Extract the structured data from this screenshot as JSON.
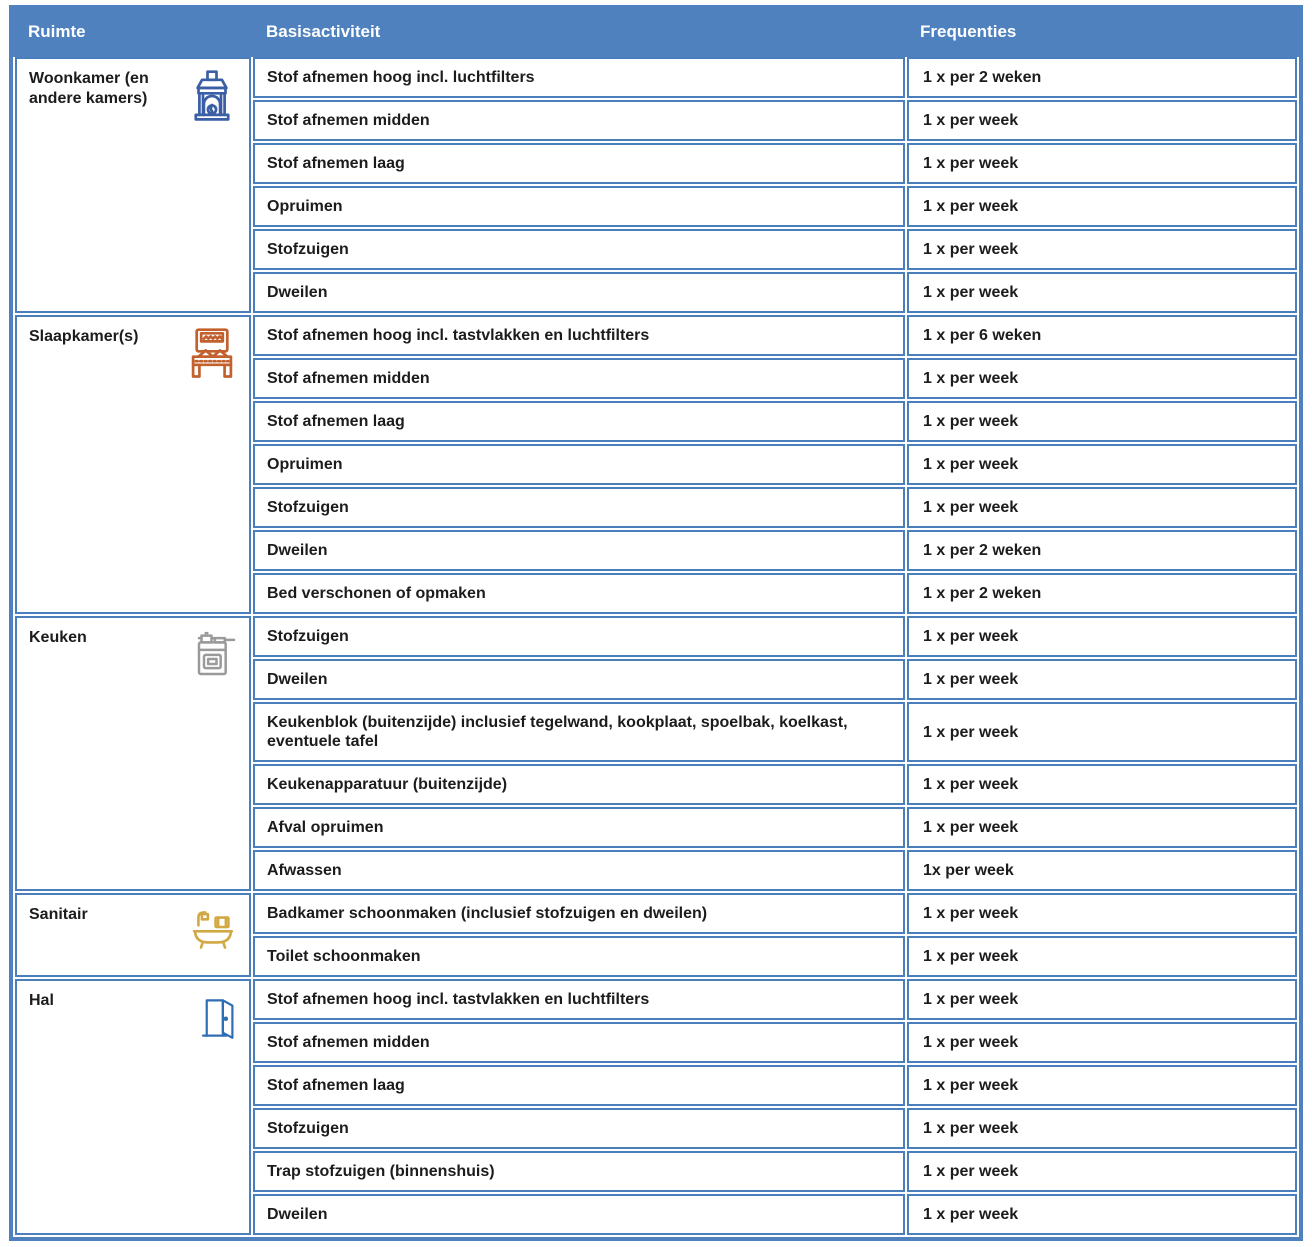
{
  "colors": {
    "header_bg": "#4e81bd",
    "cell_border": "#4a7ebc",
    "header_text": "#ffffff",
    "body_text": "#1c1c1c"
  },
  "table": {
    "headers": {
      "ruimte": "Ruimte",
      "basisactiviteit": "Basisactiviteit",
      "frequenties": "Frequenties"
    },
    "sections": [
      {
        "room": "Woonkamer (en andere kamers)",
        "icon": "fireplace-icon",
        "icon_color": "#3a5fa5",
        "rows": [
          {
            "activity": "Stof afnemen hoog incl. luchtfilters",
            "frequency": "1 x per 2 weken"
          },
          {
            "activity": "Stof afnemen midden",
            "frequency": "1 x per week"
          },
          {
            "activity": "Stof afnemen laag",
            "frequency": "1 x per week"
          },
          {
            "activity": "Opruimen",
            "frequency": "1 x per week"
          },
          {
            "activity": "Stofzuigen",
            "frequency": "1 x per week"
          },
          {
            "activity": "Dweilen",
            "frequency": "1 x per week"
          }
        ]
      },
      {
        "room": "Slaapkamer(s)",
        "icon": "bed-icon",
        "icon_color": "#c2602e",
        "rows": [
          {
            "activity": "Stof afnemen hoog incl. tastvlakken en luchtfilters",
            "frequency": "1 x per 6 weken"
          },
          {
            "activity": "Stof afnemen midden",
            "frequency": "1 x per week"
          },
          {
            "activity": "Stof afnemen laag",
            "frequency": "1 x per week"
          },
          {
            "activity": "Opruimen",
            "frequency": "1 x per week"
          },
          {
            "activity": "Stofzuigen",
            "frequency": "1 x per week"
          },
          {
            "activity": "Dweilen",
            "frequency": "1 x per 2 weken"
          },
          {
            "activity": "Bed verschonen of opmaken",
            "frequency": "1 x per 2 weken"
          }
        ]
      },
      {
        "room": "Keuken",
        "icon": "stove-icon",
        "icon_color": "#9a9a9a",
        "rows": [
          {
            "activity": "Stofzuigen",
            "frequency": "1 x per week"
          },
          {
            "activity": "Dweilen",
            "frequency": "1 x per week"
          },
          {
            "activity": "Keukenblok (buitenzijde) inclusief tegelwand, kookplaat, spoelbak, koelkast, eventuele tafel",
            "frequency": "1 x per week"
          },
          {
            "activity": "Keukenapparatuur (buitenzijde)",
            "frequency": "1 x per week"
          },
          {
            "activity": "Afval opruimen",
            "frequency": "1 x per week"
          },
          {
            "activity": "Afwassen",
            "frequency": "1x per week"
          }
        ]
      },
      {
        "room": "Sanitair",
        "icon": "bathtub-icon",
        "icon_color": "#d2a844",
        "rows": [
          {
            "activity": "Badkamer schoonmaken (inclusief stofzuigen en dweilen)",
            "frequency": "1 x per week"
          },
          {
            "activity": "Toilet schoonmaken",
            "frequency": "1 x per week"
          }
        ]
      },
      {
        "room": "Hal",
        "icon": "door-icon",
        "icon_color": "#2e6db4",
        "rows": [
          {
            "activity": "Stof afnemen hoog incl. tastvlakken en luchtfilters",
            "frequency": "1 x per week"
          },
          {
            "activity": "Stof afnemen midden",
            "frequency": "1 x per week"
          },
          {
            "activity": "Stof afnemen laag",
            "frequency": "1 x per week"
          },
          {
            "activity": "Stofzuigen",
            "frequency": "1 x per week"
          },
          {
            "activity": "Trap stofzuigen (binnenshuis)",
            "frequency": "1 x per week"
          },
          {
            "activity": "Dweilen",
            "frequency": "1 x per week"
          }
        ]
      }
    ]
  }
}
